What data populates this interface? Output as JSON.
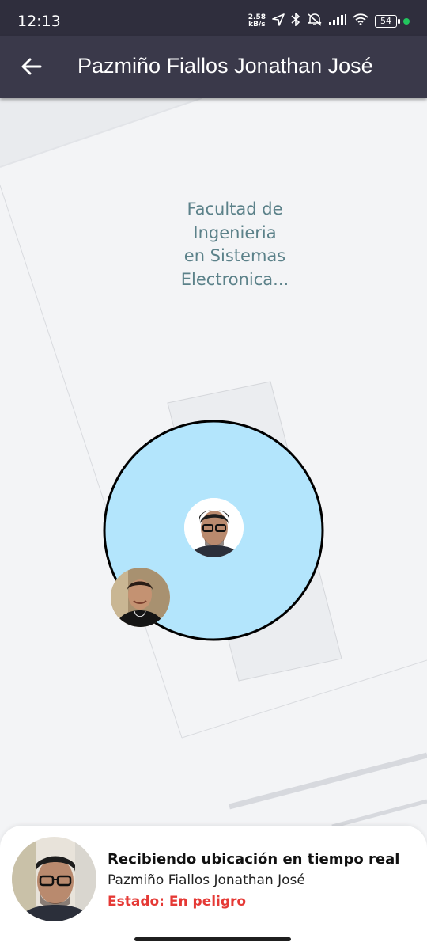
{
  "status_bar": {
    "time": "12:13",
    "net_speed_value": "2.58",
    "net_speed_unit": "kB/s",
    "battery": "54",
    "icons": [
      "location-arrow-icon",
      "bluetooth-icon",
      "muted-icon",
      "signal-icon",
      "wifi-icon",
      "battery-icon"
    ]
  },
  "app_bar": {
    "back_icon": "arrow-left-icon",
    "title": "Pazmiño Fiallos Jonathan José"
  },
  "map": {
    "place_label_lines": [
      "Facultad de",
      "Ingenieria",
      "en Sistemas",
      "Electronica..."
    ],
    "geofence_fill": "#b3e5fc",
    "geofence_stroke": "#000000",
    "markers": [
      "user-avatar-marker",
      "contact-avatar-marker"
    ]
  },
  "card": {
    "heading": "Recibiendo ubicación en tiempo real",
    "name": "Pazmiño Fiallos Jonathan José",
    "status": "Estado: En peligro",
    "status_color": "#e53935"
  }
}
